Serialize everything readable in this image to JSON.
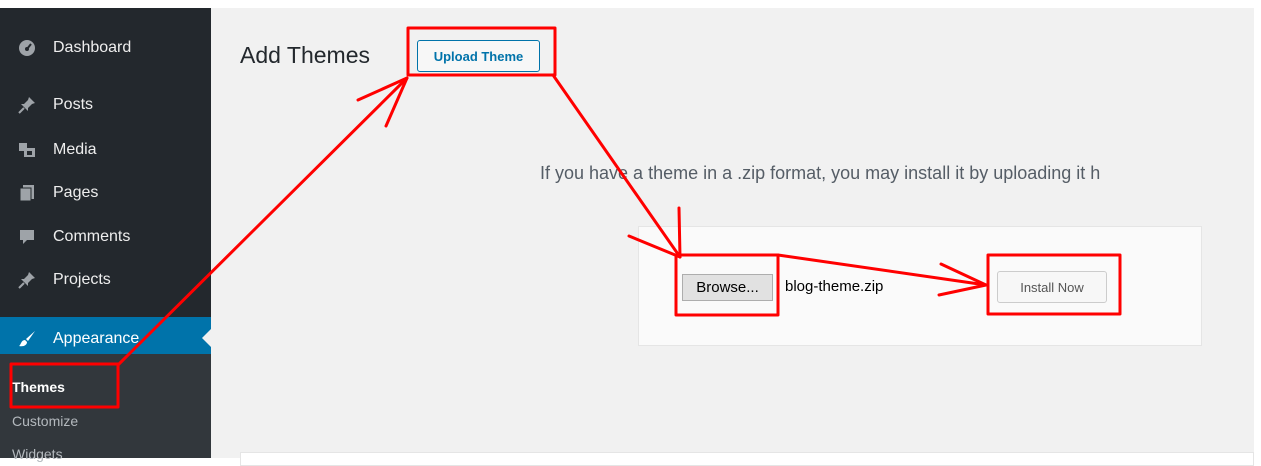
{
  "sidebar": {
    "items": [
      {
        "label": "Dashboard",
        "icon": "dashboard-icon"
      },
      {
        "label": "Posts",
        "icon": "pin-icon"
      },
      {
        "label": "Media",
        "icon": "media-icon"
      },
      {
        "label": "Pages",
        "icon": "pages-icon"
      },
      {
        "label": "Comments",
        "icon": "comment-icon"
      },
      {
        "label": "Projects",
        "icon": "pin-icon"
      },
      {
        "label": "Appearance",
        "icon": "paintbrush-icon"
      }
    ],
    "submenu": [
      "Themes",
      "Customize",
      "Widgets"
    ]
  },
  "main": {
    "title": "Add Themes",
    "upload_button": "Upload Theme",
    "intro": "If you have a theme in a .zip format, you may install it by uploading it h",
    "browse_button": "Browse...",
    "file_name": "blog-theme.zip",
    "install_button": "Install Now"
  },
  "colors": {
    "sidebar_bg": "#23282d",
    "active_bg": "#0073aa",
    "annotation": "#ff0000"
  }
}
